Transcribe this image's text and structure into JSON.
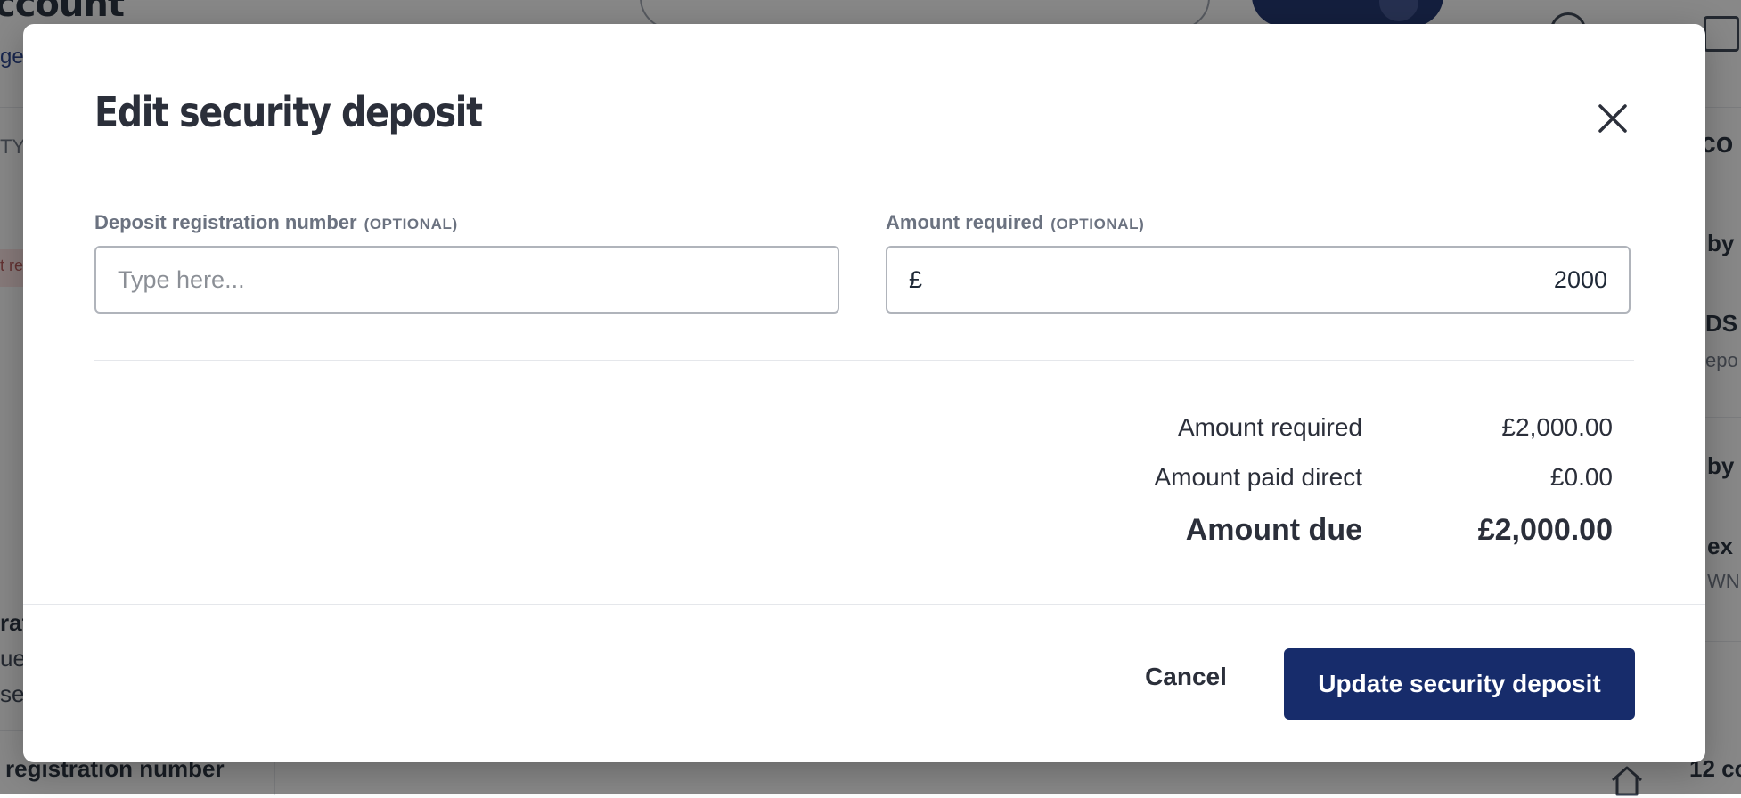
{
  "background": {
    "page_title_fragment": "ccount",
    "link_fragment": "ge",
    "label_fragment": "TY",
    "badge_fragment": "t re",
    "left_fragments": [
      "rat",
      "ued",
      "se"
    ],
    "bottom_left_text": "registration number",
    "right_fragments": [
      "co",
      "by",
      "DS",
      "epo",
      "by",
      "ex",
      "WNE"
    ],
    "bottom_right_text": "12 co"
  },
  "modal": {
    "title": "Edit security deposit",
    "fields": {
      "registration": {
        "label": "Deposit registration number",
        "optional": "(OPTIONAL)",
        "placeholder": "Type here...",
        "value": ""
      },
      "amount": {
        "label": "Amount required",
        "optional": "(OPTIONAL)",
        "currency": "£",
        "value": "2000"
      }
    },
    "summary": {
      "required_label": "Amount required",
      "required_value": "£2,000.00",
      "paid_label": "Amount paid direct",
      "paid_value": "£0.00",
      "due_label": "Amount due",
      "due_value": "£2,000.00"
    },
    "actions": {
      "cancel": "Cancel",
      "submit": "Update security deposit"
    }
  },
  "icons": {
    "close": "close-icon",
    "globe": "globe-icon",
    "gift": "gift-icon",
    "home": "home-icon"
  },
  "colors": {
    "primary": "#172c6b",
    "overlay": "rgba(17,17,17,0.5)",
    "text": "#2b2f3a",
    "muted": "#6b7280"
  }
}
